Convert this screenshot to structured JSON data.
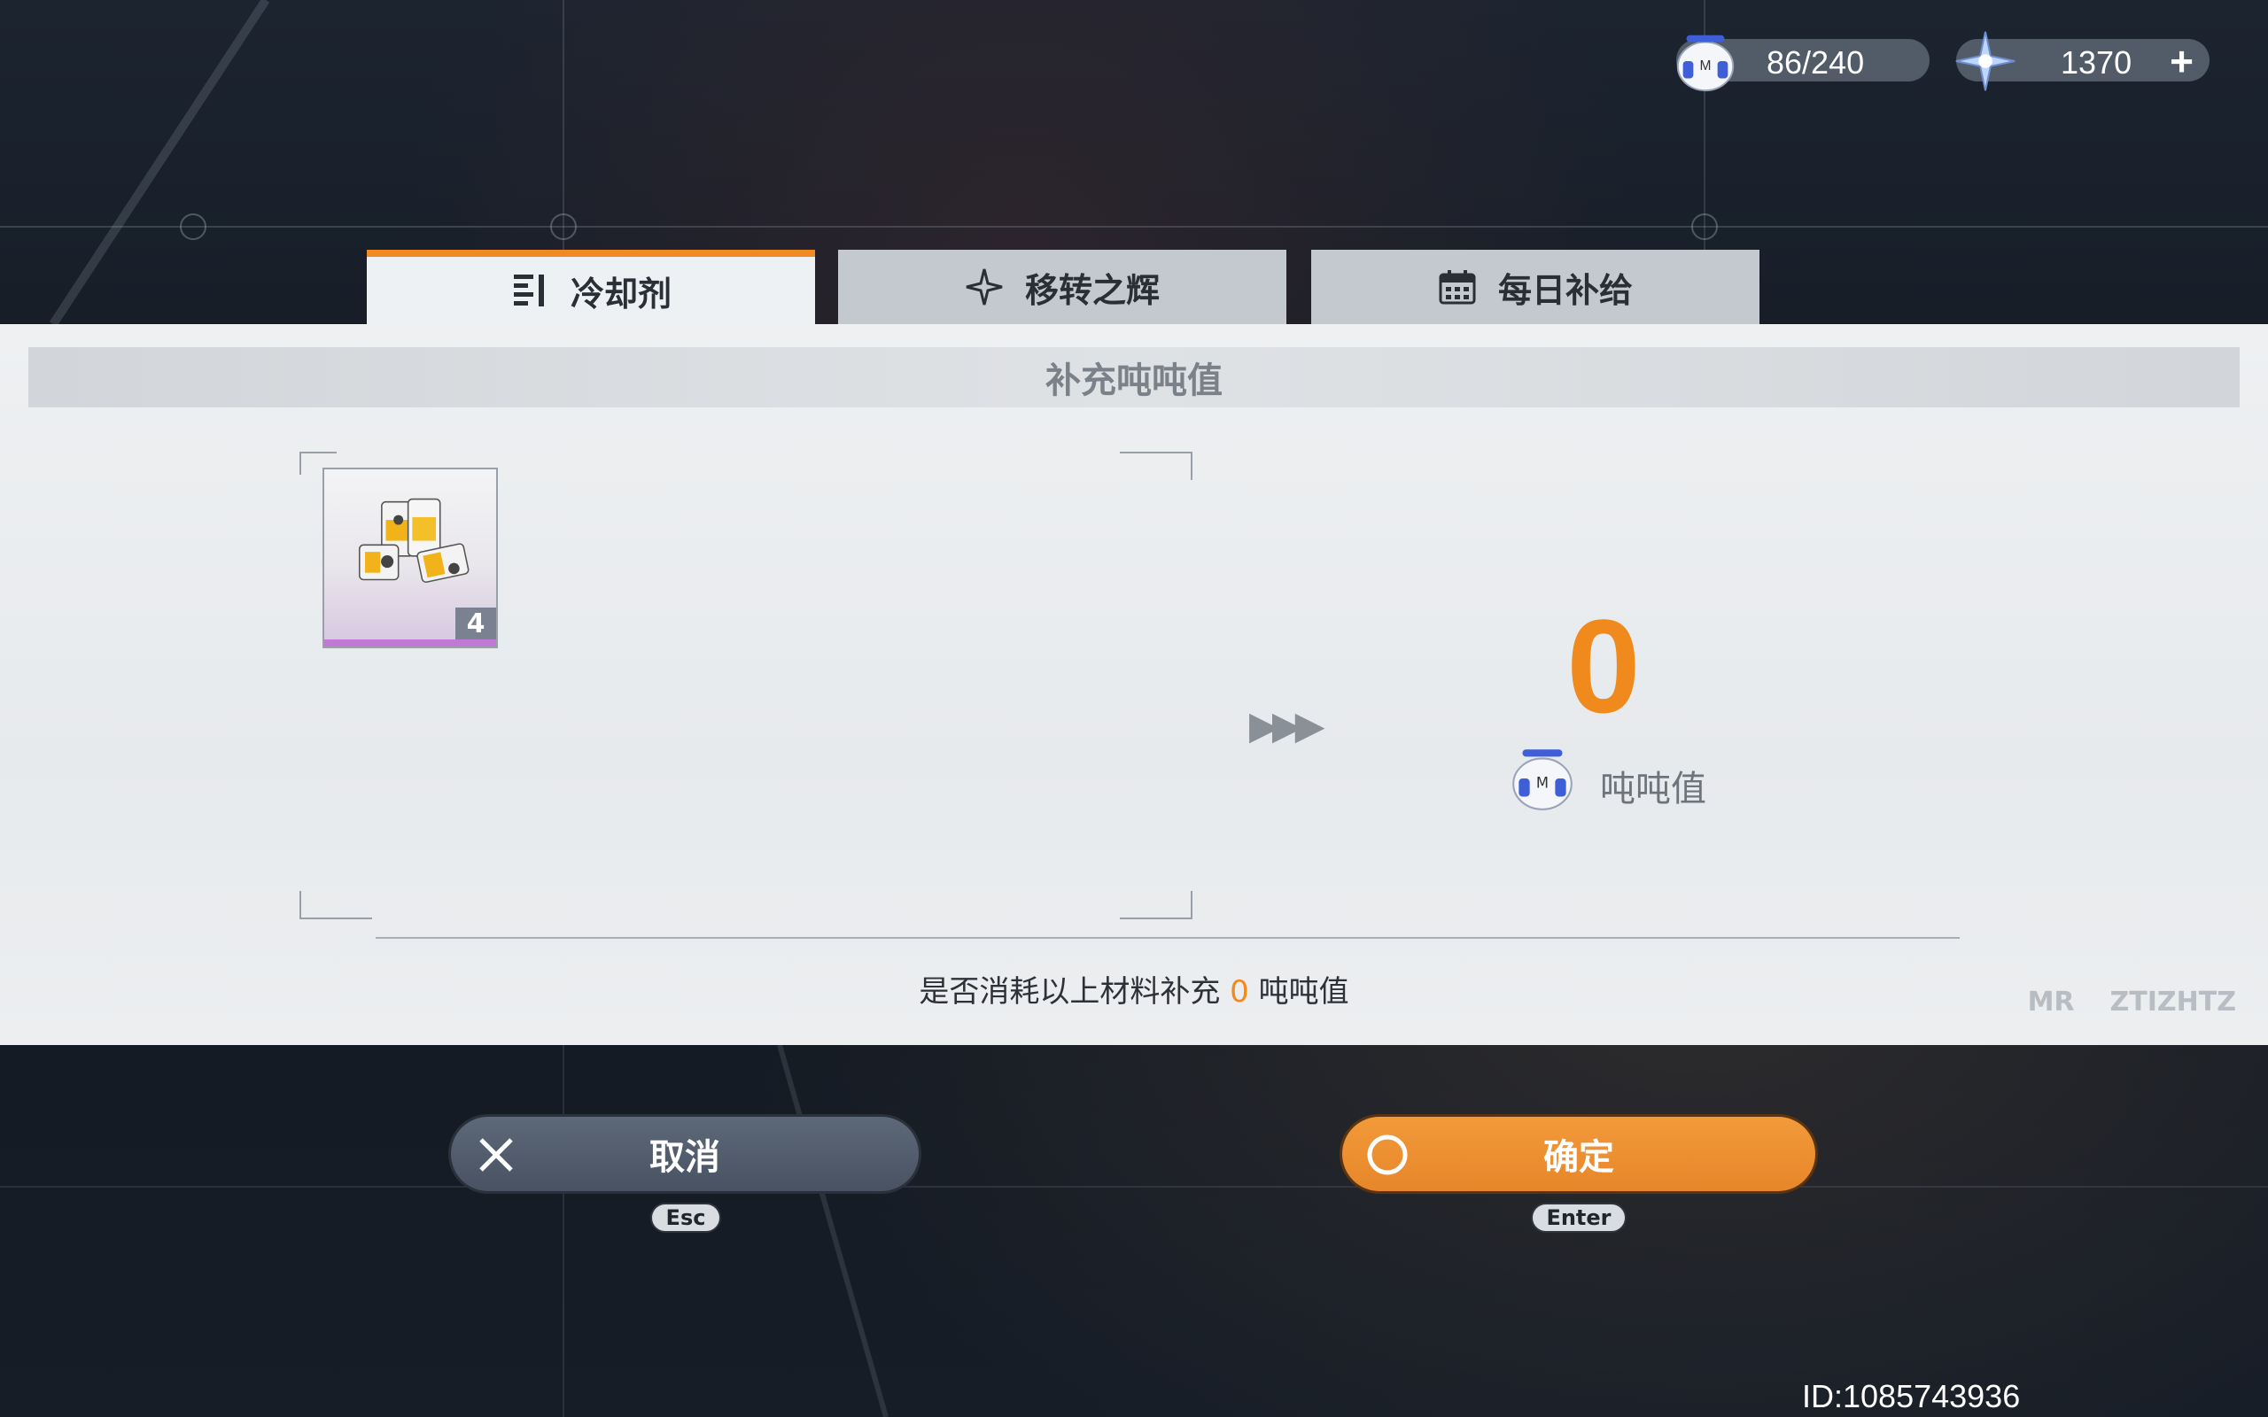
{
  "resources": {
    "stamina": {
      "icon": "bangboo-robot-icon",
      "value": "86/240"
    },
    "currency": {
      "icon": "star-crystal-icon",
      "value": "1370",
      "add_label": "+"
    }
  },
  "tabs": [
    {
      "label": "冷却剂",
      "icon": "list-icon",
      "active": true
    },
    {
      "label": "移转之辉",
      "icon": "compass-star-icon",
      "active": false
    },
    {
      "label": "每日补给",
      "icon": "calendar-icon",
      "active": false
    }
  ],
  "panel": {
    "title": "补充吨吨值",
    "item": {
      "icon": "coolant-canisters-icon",
      "count": "4"
    },
    "result": {
      "value": "0",
      "label": "吨吨值",
      "icon": "bangboo-robot-icon"
    },
    "confirm": {
      "prefix": "是否消耗以上材料补充",
      "amount": "0",
      "suffix": "吨吨值"
    },
    "logos": [
      "MR",
      "ZTIZHTZ"
    ]
  },
  "buttons": {
    "cancel": {
      "label": "取消",
      "key": "Esc",
      "icon": "close-x-icon"
    },
    "confirm": {
      "label": "确定",
      "key": "Enter",
      "icon": "circle-o-icon"
    }
  },
  "user_id": "ID:1085743936",
  "colors": {
    "accent": "#f08a1c",
    "tab_active_border": "#f08a24",
    "cancel_bg": "#4f5a6a"
  }
}
